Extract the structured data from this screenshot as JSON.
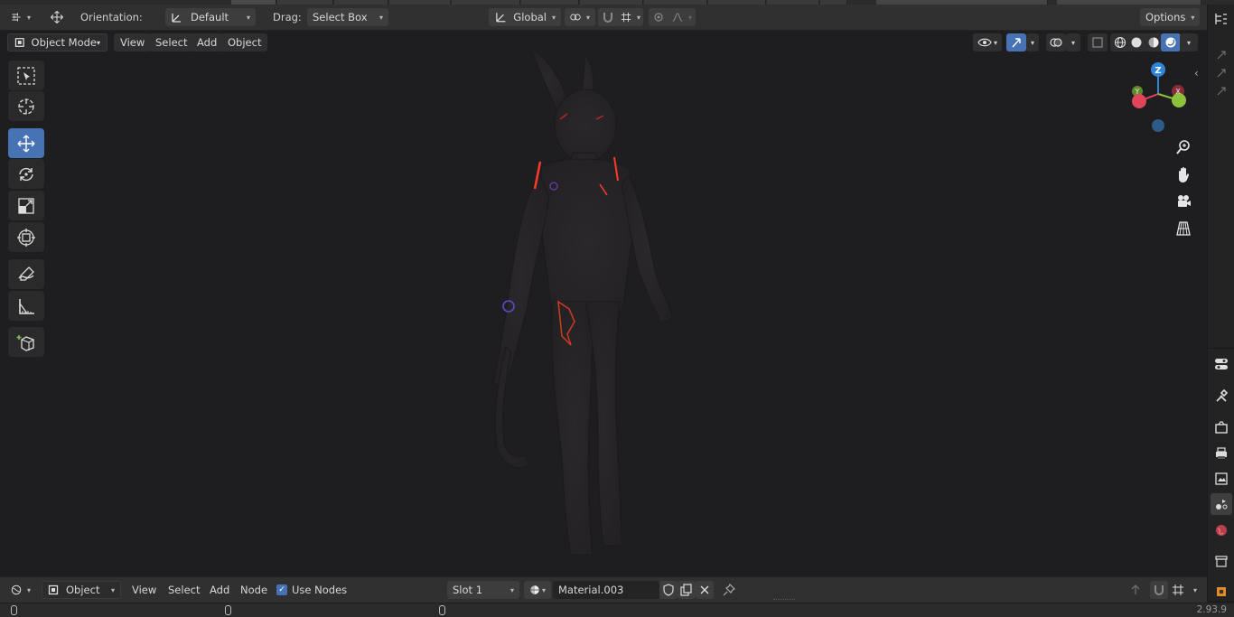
{
  "header": {
    "orientation_label": "Orientation:",
    "orientation_value": "Default",
    "drag_label": "Drag:",
    "drag_value": "Select Box",
    "transform_orientation": "Global",
    "options_label": "Options"
  },
  "viewport_header": {
    "mode": "Object Mode",
    "menus": [
      "View",
      "Select",
      "Add",
      "Object"
    ]
  },
  "tools": [
    "select-box",
    "cursor",
    "move",
    "rotate",
    "scale",
    "transform",
    "annotate",
    "measure",
    "add-cube"
  ],
  "active_tool": "move",
  "gizmo": {
    "axes": [
      "X",
      "Y",
      "Z"
    ],
    "colors": {
      "x": "#e0455a",
      "y": "#8ec13b",
      "z": "#2f86d8"
    }
  },
  "node_header": {
    "editor_type": "Object",
    "menus": [
      "View",
      "Select",
      "Add",
      "Node"
    ],
    "use_nodes_label": "Use Nodes",
    "use_nodes_checked": true,
    "slot": "Slot 1",
    "material": "Material.003"
  },
  "status": {
    "version": "2.93.9"
  },
  "colors": {
    "accent": "#4772b3",
    "header_bg": "#303030",
    "viewport_bg": "#1e1d1f"
  }
}
